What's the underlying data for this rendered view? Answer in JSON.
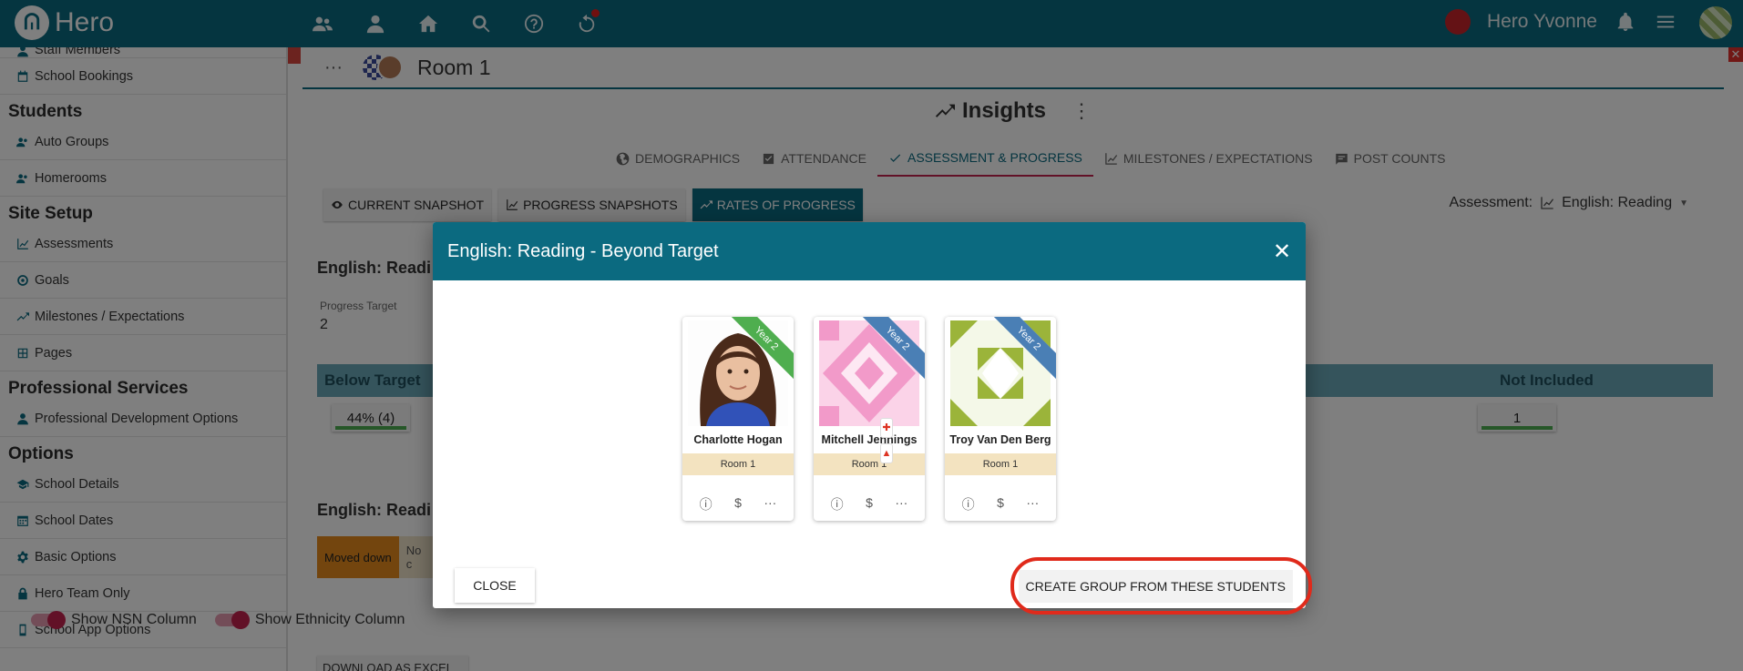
{
  "app": {
    "name": "Hero",
    "user": "Hero Yvonne"
  },
  "sidebar": {
    "items_top": [
      {
        "label": "Staff Members"
      },
      {
        "label": "School Bookings"
      }
    ],
    "sections": [
      {
        "heading": "Students",
        "items": [
          {
            "label": "Auto Groups"
          },
          {
            "label": "Homerooms"
          }
        ]
      },
      {
        "heading": "Site Setup",
        "items": [
          {
            "label": "Assessments"
          },
          {
            "label": "Goals"
          },
          {
            "label": "Milestones / Expectations"
          },
          {
            "label": "Pages"
          }
        ]
      },
      {
        "heading": "Professional Services",
        "items": [
          {
            "label": "Professional Development Options"
          }
        ]
      },
      {
        "heading": "Options",
        "items": [
          {
            "label": "School Details"
          },
          {
            "label": "School Dates"
          },
          {
            "label": "Basic Options"
          },
          {
            "label": "Hero Team Only"
          },
          {
            "label": "School App Options"
          }
        ]
      }
    ]
  },
  "room": {
    "title": "Room 1"
  },
  "insights": {
    "title": "Insights"
  },
  "tabs": [
    {
      "label": "DEMOGRAPHICS"
    },
    {
      "label": "ATTENDANCE"
    },
    {
      "label": "ASSESSMENT & PROGRESS"
    },
    {
      "label": "MILESTONES / EXPECTATIONS"
    },
    {
      "label": "POST COUNTS"
    }
  ],
  "subtabs": [
    {
      "label": "CURRENT SNAPSHOT"
    },
    {
      "label": "PROGRESS SNAPSHOTS"
    },
    {
      "label": "RATES OF PROGRESS"
    }
  ],
  "assessment": {
    "label": "Assessment:",
    "value": "English: Reading"
  },
  "background": {
    "heading1": "English: Readi",
    "progress_target_label": "Progress Target",
    "progress_target_value": "2",
    "col_below": "Below Target",
    "col_not_included": "Not Included",
    "below_value": "44% (4)",
    "not_included_value": "1",
    "heading2": "English: Readi",
    "moved_down": "Moved down",
    "no_change": "No c",
    "toggle_nsn": "Show NSN Column",
    "toggle_ethnicity": "Show Ethnicity Column",
    "download": "DOWNLOAD AS EXCEL"
  },
  "modal": {
    "title": "English: Reading - Beyond Target",
    "close_label": "CLOSE",
    "create_label": "CREATE GROUP FROM THESE STUDENTS",
    "students": [
      {
        "name": "Charlotte Hogan",
        "room": "Room 1",
        "year": "Year 2",
        "ribbon_color": "#4fae4f"
      },
      {
        "name": "Mitchell Jennings",
        "room": "Room 1",
        "year": "Year 2",
        "ribbon_color": "#4a7fb5"
      },
      {
        "name": "Troy Van Den Berg",
        "room": "Room 1",
        "year": "Year 2",
        "ribbon_color": "#4a7fb5"
      }
    ]
  },
  "colors": {
    "brand": "#0b6a80",
    "accent": "#c4234e",
    "highlight": "#e02a1b"
  }
}
